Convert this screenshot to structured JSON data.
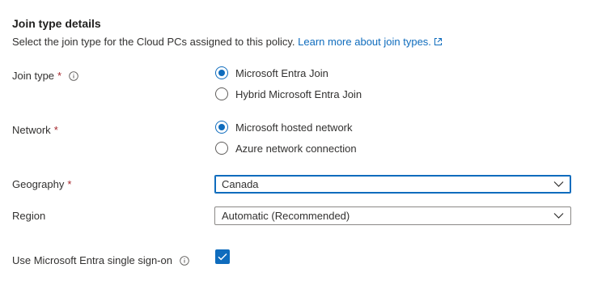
{
  "section": {
    "title": "Join type details",
    "description": "Select the join type for the Cloud PCs assigned to this policy.",
    "learn_more_link": "Learn more about join types."
  },
  "fields": {
    "join_type": {
      "label": "Join type",
      "required_mark": "*",
      "options": [
        {
          "label": "Microsoft Entra Join",
          "selected": true
        },
        {
          "label": "Hybrid Microsoft Entra Join",
          "selected": false
        }
      ]
    },
    "network": {
      "label": "Network",
      "required_mark": "*",
      "options": [
        {
          "label": "Microsoft hosted network",
          "selected": true
        },
        {
          "label": "Azure network connection",
          "selected": false
        }
      ]
    },
    "geography": {
      "label": "Geography",
      "required_mark": "*",
      "selected_value": "Canada"
    },
    "region": {
      "label": "Region",
      "selected_value": "Automatic (Recommended)"
    },
    "sso": {
      "label": "Use Microsoft Entra single sign-on",
      "checked": true
    }
  },
  "colors": {
    "accent": "#0f6cbd",
    "required": "#a4262c",
    "text": "#323130"
  },
  "icons": {
    "info": "info-icon",
    "external_link": "external-link-icon",
    "chevron": "chevron-down-icon",
    "check": "checkmark-icon"
  }
}
